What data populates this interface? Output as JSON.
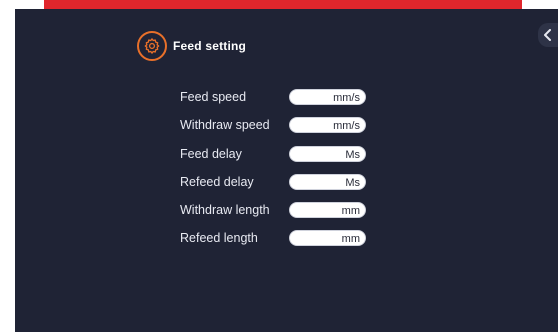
{
  "header": {
    "title": "Feed setting",
    "icon": "gear-icon",
    "icon_color": "#e8702a"
  },
  "back_button": {
    "icon": "chevron-left-icon"
  },
  "settings": [
    {
      "label": "Feed speed",
      "unit": "mm/s",
      "value": ""
    },
    {
      "label": "Withdraw speed",
      "unit": "mm/s",
      "value": ""
    },
    {
      "label": "Feed delay",
      "unit": "Ms",
      "value": ""
    },
    {
      "label": "Refeed delay",
      "unit": "Ms",
      "value": ""
    },
    {
      "label": "Withdraw length",
      "unit": "mm",
      "value": ""
    },
    {
      "label": "Refeed length",
      "unit": "mm",
      "value": ""
    }
  ],
  "colors": {
    "background": "#1f2335",
    "accent": "#e8702a",
    "top_bar": "#e0262c"
  }
}
